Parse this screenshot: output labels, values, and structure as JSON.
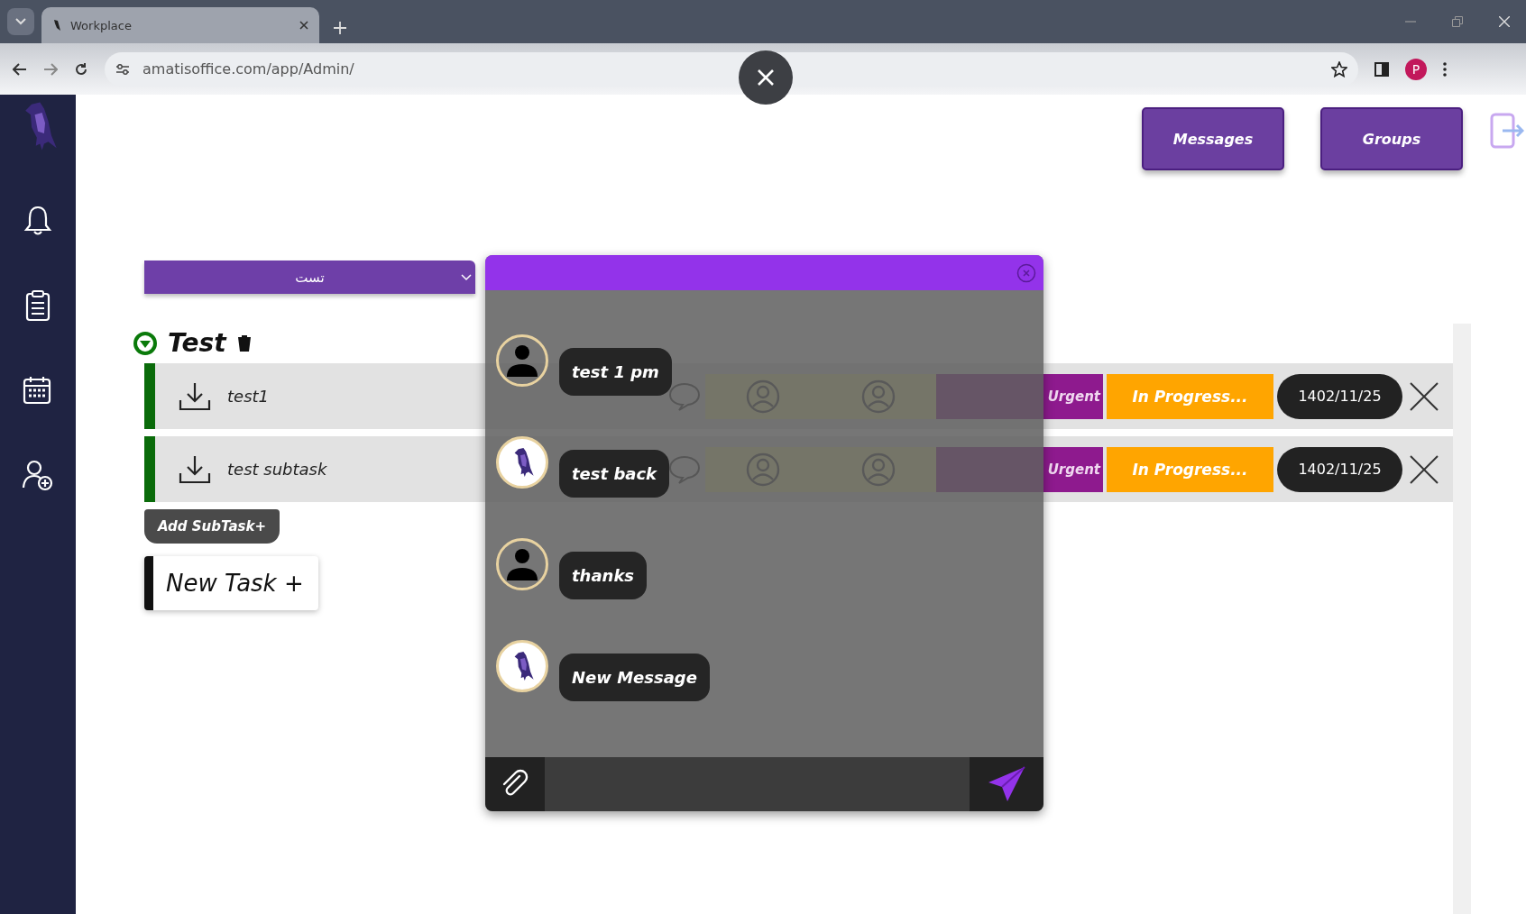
{
  "browser": {
    "tab_title": "Workplace",
    "url": "amatisoffice.com/app/Admin/",
    "profile_initial": "P"
  },
  "header_buttons": [
    {
      "label": "Messages"
    },
    {
      "label": "Groups"
    }
  ],
  "project_selector": {
    "value": "تست"
  },
  "task": {
    "title": "Test",
    "expanded": true,
    "subtasks": [
      {
        "name": "test1",
        "priority": "Urgent",
        "status": "In Progress...",
        "date": "1402/11/25"
      },
      {
        "name": "test subtask",
        "priority": "Urgent",
        "status": "In Progress...",
        "date": "1402/11/25"
      }
    ]
  },
  "add_subtask": "Add SubTask+",
  "new_task": "New Task +",
  "chat": {
    "messages": [
      {
        "text": "test 1 pm",
        "kind": "person"
      },
      {
        "text": "test back",
        "kind": "bird"
      },
      {
        "text": "thanks",
        "kind": "person"
      },
      {
        "text": "New Message",
        "kind": "bird"
      }
    ]
  }
}
